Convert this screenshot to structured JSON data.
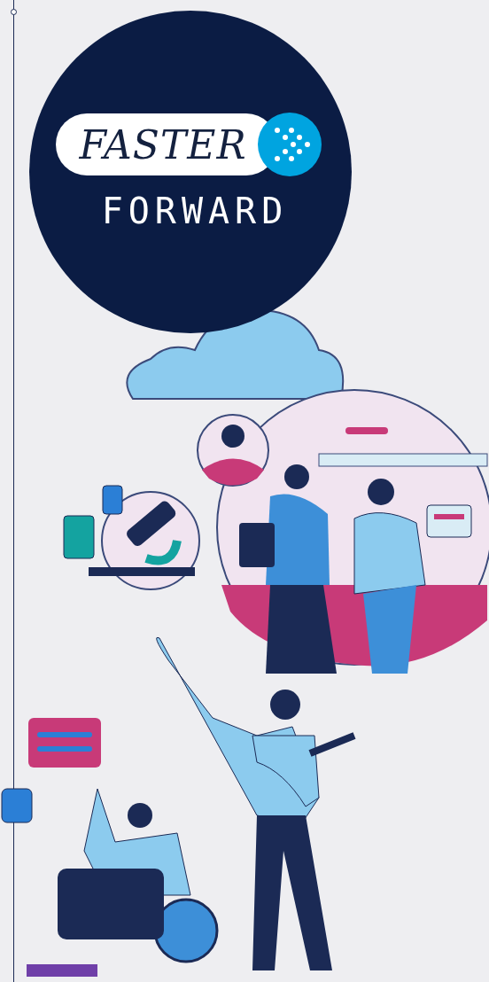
{
  "logo": {
    "word_1": "FASTER",
    "word_2": "FORWARD"
  }
}
